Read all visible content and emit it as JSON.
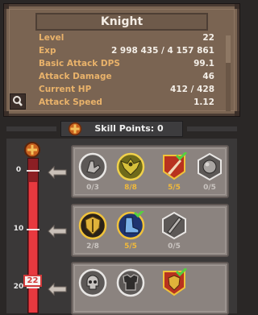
{
  "panel": {
    "title": "Knight",
    "stats": [
      {
        "label": "Level",
        "value": "22"
      },
      {
        "label": "Exp",
        "value": "2 998 435 / 4 157 861"
      },
      {
        "label": "Basic Attack DPS",
        "value": "99.1"
      },
      {
        "label": "Attack Damage",
        "value": "46"
      },
      {
        "label": "Current HP",
        "value": "412 / 428"
      },
      {
        "label": "Attack Speed",
        "value": "1.12"
      }
    ]
  },
  "skill_points": {
    "label": "Skill Points: 0"
  },
  "tree": {
    "level": "22",
    "level_progress": 0.85,
    "tiers": [
      {
        "level_label": "0",
        "skills": [
          {
            "icon": "gauntlet-icon",
            "count": "0/3",
            "state": "empty"
          },
          {
            "icon": "wings-emblem-icon",
            "count": "8/8",
            "state": "maxed"
          },
          {
            "icon": "slash-icon",
            "count": "5/5",
            "state": "maxed"
          },
          {
            "icon": "orb-icon",
            "count": "0/5",
            "state": "empty"
          }
        ]
      },
      {
        "level_label": "10",
        "skills": [
          {
            "icon": "shield-icon",
            "count": "2/8",
            "state": "partial"
          },
          {
            "icon": "boot-icon",
            "count": "5/5",
            "state": "maxed"
          },
          {
            "icon": "blade-icon",
            "count": "0/5",
            "state": "empty"
          }
        ]
      },
      {
        "level_label": "20",
        "skills": [
          {
            "icon": "skull-icon",
            "count": "",
            "state": "empty"
          },
          {
            "icon": "armor-icon",
            "count": "",
            "state": "empty"
          },
          {
            "icon": "banner-shield-icon",
            "count": "",
            "state": "maxed"
          }
        ]
      }
    ]
  },
  "colors": {
    "gold_label": "#e9b26a",
    "maxed_count": "#f0b93b",
    "empty_count": "#c9c4c0",
    "progress_fill": "#e8393f"
  }
}
